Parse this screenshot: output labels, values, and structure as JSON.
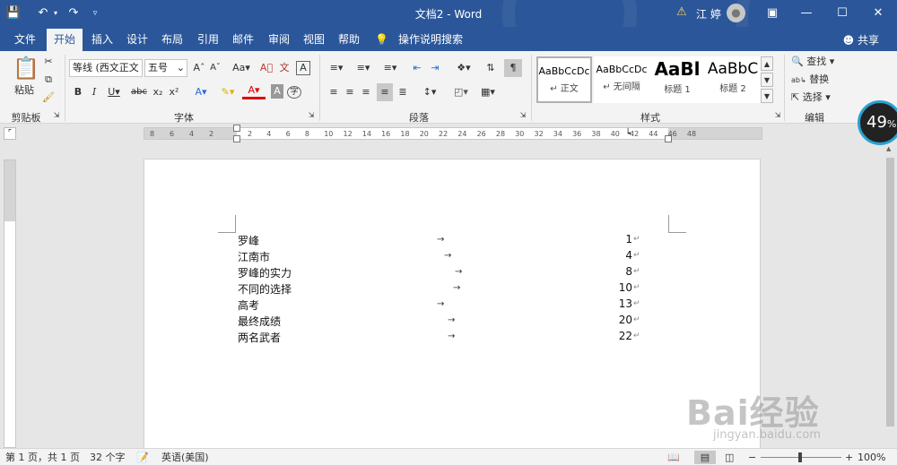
{
  "titlebar": {
    "doc_title": "文档2 - Word",
    "user_name": "江 婷",
    "icons": [
      "save-icon",
      "undo-icon",
      "redo-icon",
      "customize-icon",
      "warning-icon",
      "ribbon-display-icon",
      "minimize-icon",
      "maximize-icon",
      "close-icon"
    ]
  },
  "tabs": {
    "items": [
      {
        "label": "文件",
        "active": false
      },
      {
        "label": "开始",
        "active": true
      },
      {
        "label": "插入",
        "active": false
      },
      {
        "label": "设计",
        "active": false
      },
      {
        "label": "布局",
        "active": false
      },
      {
        "label": "引用",
        "active": false
      },
      {
        "label": "邮件",
        "active": false
      },
      {
        "label": "审阅",
        "active": false
      },
      {
        "label": "视图",
        "active": false
      },
      {
        "label": "帮助",
        "active": false
      }
    ],
    "tell_me": "操作说明搜索",
    "share": "共享"
  },
  "ribbon": {
    "clipboard": {
      "paste": "粘贴",
      "group": "剪贴板"
    },
    "font": {
      "name": "等线 (西文正文",
      "size": "五号",
      "group": "字体",
      "aa": "Aa"
    },
    "paragraph": {
      "group": "段落"
    },
    "styles": {
      "group": "样式",
      "items": [
        {
          "preview": "AaBbCcDc",
          "name": "正文"
        },
        {
          "preview": "AaBbCcDc",
          "name": "无间隔"
        },
        {
          "preview": "AaBl",
          "name": "标题 1"
        },
        {
          "preview": "AaBbC",
          "name": "标题 2"
        }
      ]
    },
    "editing": {
      "find": "查找",
      "replace": "替换",
      "select": "选择",
      "group": "编辑"
    }
  },
  "ruler": {
    "ticks": [
      "8",
      "6",
      "4",
      "2",
      "2",
      "4",
      "6",
      "8",
      "10",
      "12",
      "14",
      "16",
      "18",
      "20",
      "22",
      "24",
      "26",
      "28",
      "30",
      "32",
      "34",
      "36",
      "38",
      "40",
      "42",
      "44",
      "46",
      "48"
    ]
  },
  "document": {
    "toc": [
      {
        "title": "罗峰",
        "page": "1"
      },
      {
        "title": "江南市",
        "page": "4"
      },
      {
        "title": "罗峰的实力",
        "page": "8"
      },
      {
        "title": "不同的选择",
        "page": "10"
      },
      {
        "title": "高考",
        "page": "13"
      },
      {
        "title": "最终成绩",
        "page": "20"
      },
      {
        "title": "两名武者",
        "page": "22"
      }
    ],
    "tab_arrow": "→",
    "para_mark": "↵"
  },
  "status": {
    "page": "第 1 页，共 1 页",
    "words": "32 个字",
    "lang": "英语(美国)",
    "zoom": "100%"
  },
  "overlay": {
    "progress": "49",
    "progress_unit": "%",
    "watermark": "Bai经验",
    "watermark_url": "jingyan.baidu.com"
  }
}
